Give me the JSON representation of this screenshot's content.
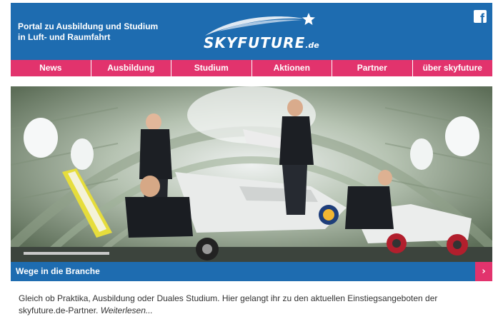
{
  "header": {
    "tagline_line1": "Portal zu Ausbildung und Studium",
    "tagline_line2": "in Luft- und Raumfahrt",
    "logo_text": "SKYFUTURE",
    "logo_suffix": ".de",
    "facebook_glyph": "f"
  },
  "nav": {
    "items": [
      "News",
      "Ausbildung",
      "Studium",
      "Aktionen",
      "Partner",
      "über skyfuture"
    ]
  },
  "feature": {
    "title": "Wege in die Branche",
    "arrow": "›",
    "text": "Gleich ob Praktika, Ausbildung oder Duales Studium. Hier gelangt ihr zu den aktuellen Einstiegsangeboten der skyfuture.de-Partner.",
    "read_more": "Weiterlesen..."
  },
  "icons": [
    "star-swoosh-logo-icon",
    "facebook-icon",
    "chevron-right-icon"
  ],
  "colors": {
    "brand_blue": "#1e6cb0",
    "accent_pink": "#e2336d"
  }
}
